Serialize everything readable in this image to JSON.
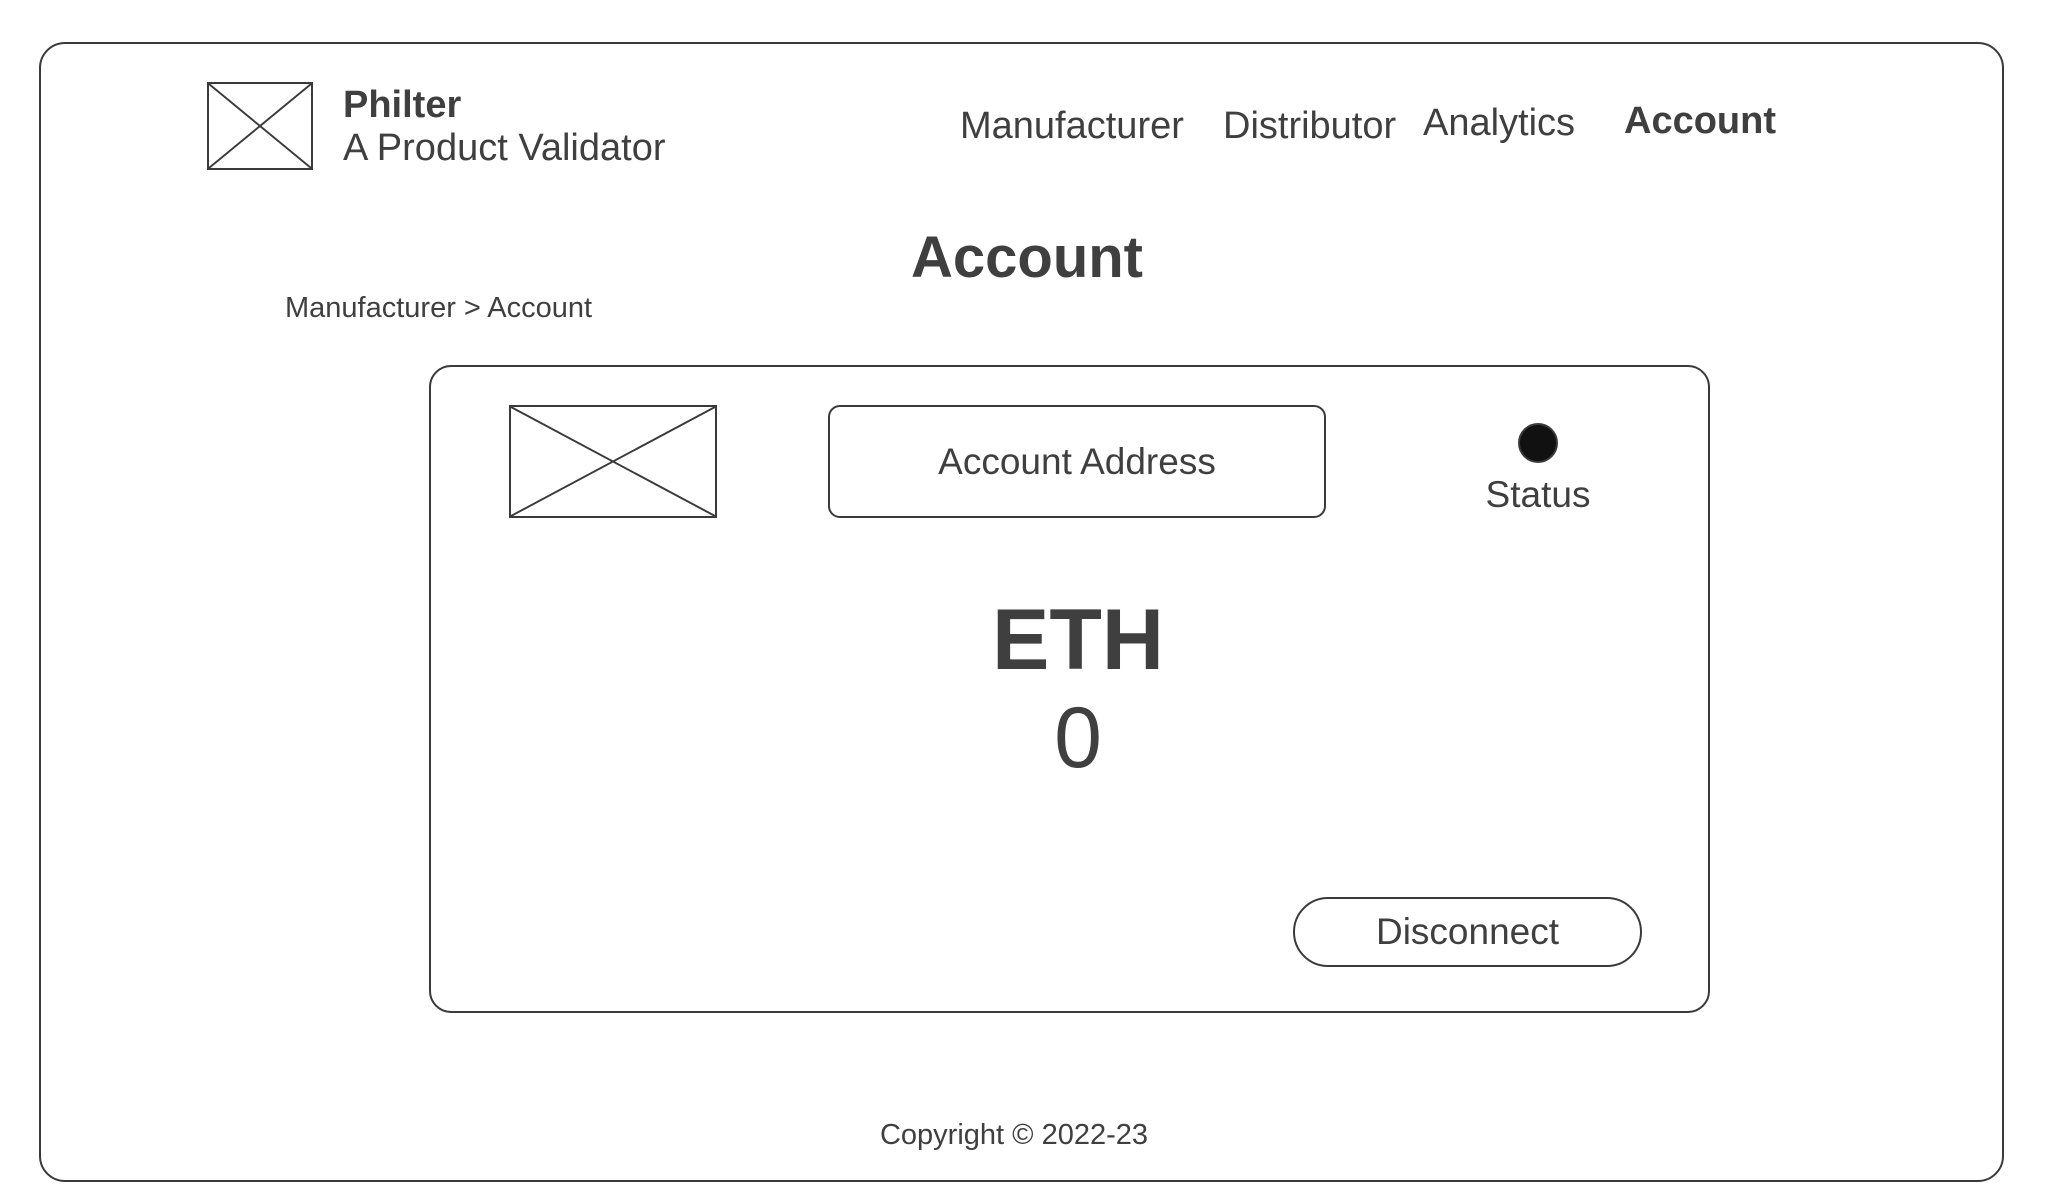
{
  "header": {
    "brand_name": "Philter",
    "brand_tagline": "A Product Validator",
    "logo_icon": "image-placeholder-icon",
    "nav": [
      {
        "label": "Manufacturer",
        "active": false
      },
      {
        "label": "Distributor",
        "active": false
      },
      {
        "label": "Analytics",
        "active": false
      },
      {
        "label": "Account",
        "active": true
      }
    ]
  },
  "page": {
    "title": "Account",
    "breadcrumb": "Manufacturer > Account"
  },
  "account_card": {
    "avatar_icon": "image-placeholder-icon",
    "address_label": "Account Address",
    "status_label": "Status",
    "status_color": "#111111",
    "currency": "ETH",
    "balance": "0",
    "disconnect_label": "Disconnect"
  },
  "footer": {
    "copyright": "Copyright © 2022-23"
  },
  "colors": {
    "stroke": "#3a3a3a",
    "text": "#3f3f3f",
    "background": "#ffffff"
  }
}
